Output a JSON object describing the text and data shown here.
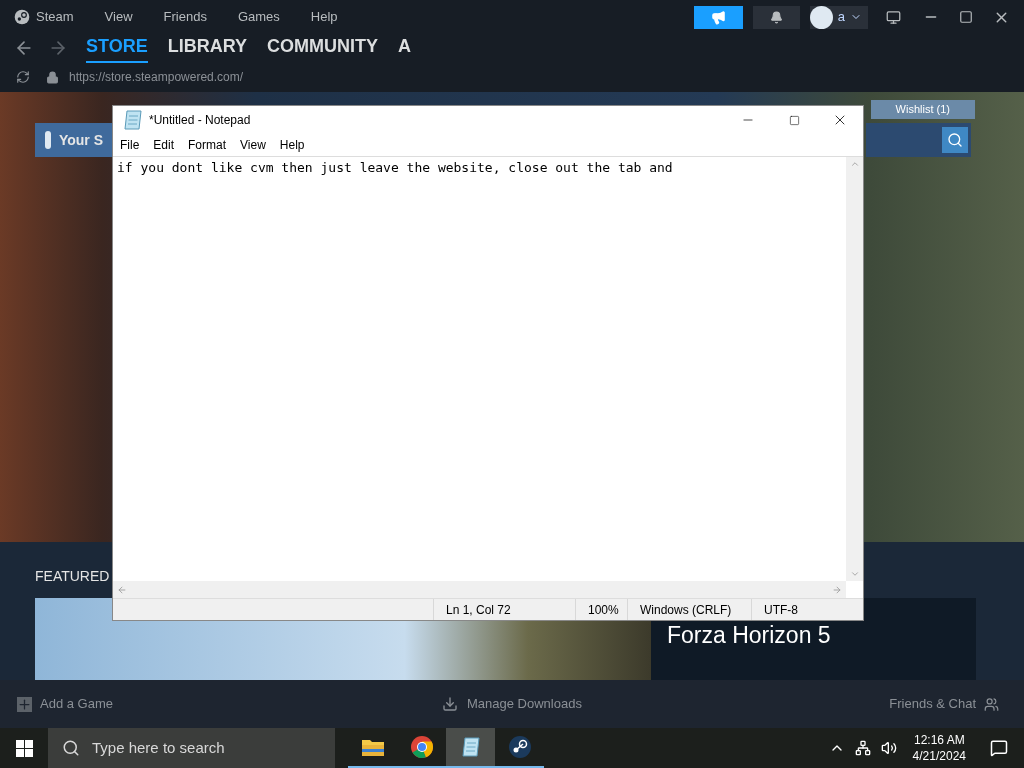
{
  "steam": {
    "menu": [
      "Steam",
      "View",
      "Friends",
      "Games",
      "Help"
    ],
    "account": "a",
    "nav_tabs": [
      {
        "label": "STORE",
        "selected": true
      },
      {
        "label": "LIBRARY",
        "selected": false
      },
      {
        "label": "COMMUNITY",
        "selected": false
      },
      {
        "label": "A",
        "selected": false
      }
    ],
    "url": "https://store.steampowered.com/",
    "store": {
      "your_store": "Your S",
      "wishlist": "Wishlist (1)",
      "featured": "FEATURED",
      "featured_title": "Forza Horizon 5"
    },
    "bottom_bar": {
      "add_game": "Add a Game",
      "downloads": "Manage Downloads",
      "friends": "Friends & Chat"
    }
  },
  "notepad": {
    "title": "*Untitled - Notepad",
    "menu": [
      "File",
      "Edit",
      "Format",
      "View",
      "Help"
    ],
    "text": "if you dont like cvm then just leave the website, close out the tab and",
    "status": [
      "Ln 1, Col 72",
      "100%",
      "Windows (CRLF)",
      "UTF-8"
    ]
  },
  "taskbar": {
    "search_placeholder": "Type here to search",
    "apps": [
      {
        "kind": "explorer",
        "selected": false
      },
      {
        "kind": "chrome",
        "selected": false
      },
      {
        "kind": "notepad",
        "selected": true
      },
      {
        "kind": "steam",
        "selected": false
      }
    ],
    "time": "12:16 AM",
    "date": "4/21/2024"
  }
}
